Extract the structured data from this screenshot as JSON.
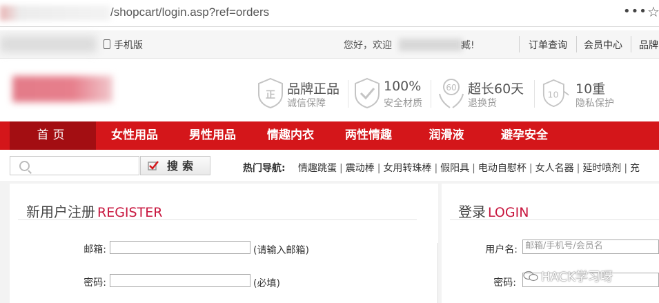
{
  "browser": {
    "url_visible": "/shopcart/login.asp?ref=orders",
    "menu_glyph": "•••",
    "star_glyph": "☆"
  },
  "topbar": {
    "mobile_label": "手机版",
    "greeting_start": "您好，欢迎",
    "greeting_end": "臧!",
    "links": [
      "订单查询",
      "会员中心",
      "品牌"
    ]
  },
  "features": [
    {
      "title": "品牌正品",
      "sub": "诚信保障",
      "icon": "shield-icon"
    },
    {
      "title": "100%",
      "sub": "安全材质",
      "icon": "shield-check-icon"
    },
    {
      "title": "超长60天",
      "sub": "退换货",
      "icon": "hands-60-icon"
    },
    {
      "title": "10重",
      "sub": "隐私保护",
      "icon": "shield-10-icon"
    }
  ],
  "nav": {
    "items": [
      "首页",
      "女性用品",
      "男性用品",
      "情趣内衣",
      "两性情趣",
      "润滑液",
      "避孕安全"
    ],
    "active_color": "#a30e12",
    "bar_color": "#d4161a"
  },
  "search": {
    "placeholder": "",
    "button_label": "搜索",
    "hot_title": "热门导航:",
    "hot_links": [
      "情趣跳蛋",
      "震动棒",
      "女用转珠棒",
      "假阳具",
      "电动自慰杯",
      "女人名器",
      "延时喷剂",
      "充"
    ]
  },
  "register": {
    "title_cn": "新用户注册",
    "title_en": "REGISTER",
    "email_label": "邮箱:",
    "email_hint": "(请输入邮箱)",
    "password_label": "密码:",
    "password_hint": "(必填)"
  },
  "login": {
    "title_cn": "登录",
    "title_en": "LOGIN",
    "username_label": "用户名:",
    "username_placeholder": "邮箱/手机号/会员名",
    "password_label": "密码:"
  },
  "watermark": "HACK学习呀",
  "colors": {
    "accent_red": "#d4161a",
    "title_en": "#c8173f"
  }
}
